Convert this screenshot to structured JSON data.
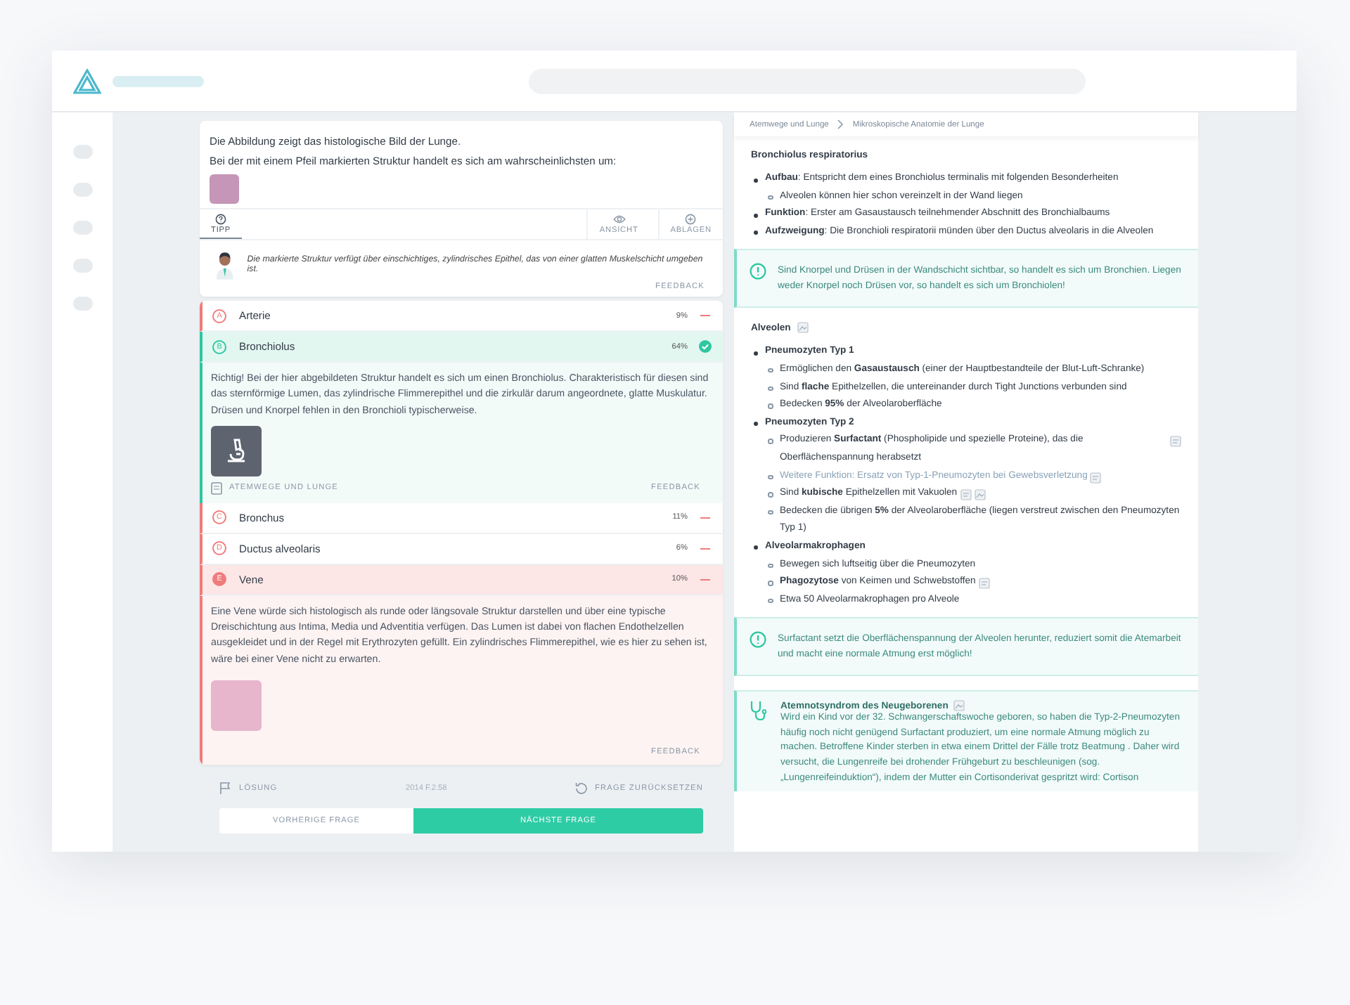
{
  "question": {
    "lines": [
      "Die Abbildung zeigt das histologische Bild der Lunge.",
      "Bei der mit einem Pfeil markierten Struktur handelt es sich am wahrscheinlichsten um:"
    ],
    "tabs": [
      {
        "label": "TIPP",
        "selected": true
      },
      {
        "label": "ANSICHT",
        "selected": false
      },
      {
        "label": "ABLAGEN",
        "selected": false
      }
    ],
    "hint": "Die markierte Struktur verfügt über einschichtiges, zylindrisches Epithel, das von einer glatten Muskelschicht umgeben ist.",
    "feedback": "FEEDBACK"
  },
  "answers": [
    {
      "letter": "A",
      "label": "Arterie",
      "percent": "9%",
      "correct": false,
      "selected": false,
      "expanded": false
    },
    {
      "letter": "B",
      "label": "Bronchiolus",
      "percent": "64%",
      "correct": true,
      "selected": false,
      "expanded": true,
      "explanation": "Richtig! Bei der hier abgebildeten Struktur handelt es sich um einen Bronchiolus. Charakteristisch für diesen sind das sternförmige Lumen, das zylindrische Flimmerepithel und die zirkulär darum angeordnete, glatte Muskulatur. Drüsen und Knorpel fehlen in den Bronchioli typischerweise.",
      "media": {
        "kind": "icon-tile"
      },
      "topic": "ATEMWEGE UND LUNGE",
      "feedback": "FEEDBACK"
    },
    {
      "letter": "C",
      "label": "Bronchus",
      "percent": "11%",
      "correct": false,
      "selected": false,
      "expanded": false
    },
    {
      "letter": "D",
      "label": "Ductus alveolaris",
      "percent": "6%",
      "correct": false,
      "selected": false,
      "expanded": false
    },
    {
      "letter": "E",
      "label": "Vene",
      "percent": "10%",
      "correct": false,
      "selected": true,
      "expanded": true,
      "explanation": "Eine Vene würde sich histologisch als runde oder längsovale Struktur darstellen und über eine typische Dreischichtung aus Intima, Media und Adventitia verfügen. Das Lumen ist dabei von flachen Endothelzellen ausgekleidet und in der Regel mit Erythrozyten gefüllt. Ein zylindrisches Flimmerepithel, wie es hier zu sehen ist, wäre bei einer Vene nicht zu erwarten.",
      "media": {
        "kind": "photo"
      },
      "feedback": "FEEDBACK"
    }
  ],
  "footer": {
    "solution": "LÖSUNG",
    "code": "2014 F.2.58",
    "reset": "FRAGE ZURÜCKSETZEN"
  },
  "nav": [
    {
      "label": "VORHERIGE FRAGE",
      "primary": false
    },
    {
      "label": "NÄCHSTE FRAGE",
      "primary": true
    }
  ],
  "breadcrumb": [
    "Atemwege und Lunge",
    "Mikroskopische Anatomie der Lunge"
  ],
  "article": [
    {
      "kind": "heading",
      "text": "Bronchiolus respiratorius"
    },
    {
      "kind": "list",
      "items": [
        {
          "text": "**Aufbau**: Entspricht dem eines Bronchiolus terminalis mit folgenden Besonderheiten",
          "bold": false,
          "children": [
            {
              "text": "Alveolen können hier schon vereinzelt in der Wand liegen",
              "muted": false
            }
          ]
        },
        {
          "text": "**Funktion**: Erster am Gasaustausch teilnehmender Abschnitt des Bronchialbaums",
          "bold": false
        },
        {
          "text": "**Aufzweigung**: Die Bronchioli respiratorii münden über den Ductus alveolaris in die Alveolen",
          "bold": false
        }
      ]
    },
    {
      "kind": "callout",
      "text": "Sind Knorpel und Drüsen in der Wandschicht sichtbar, so handelt es sich um Bronchien. Liegen weder Knorpel noch Drüsen vor, so handelt es sich um Bronchiolen!"
    },
    {
      "kind": "heading",
      "text": "Alveolen",
      "attachments": [
        {
          "kind": "image"
        }
      ]
    },
    {
      "kind": "list",
      "items": [
        {
          "text": "Pneumozyten Typ 1",
          "bold": true,
          "children": [
            {
              "text": "Ermöglichen den **Gasaustausch** (einer der Hauptbestandteile der Blut-Luft-Schranke)",
              "muted": false
            },
            {
              "text": "Sind **flache** Epithelzellen, die untereinander durch Tight Junctions verbunden sind",
              "muted": false
            },
            {
              "text": "Bedecken **95%** der Alveolaroberfläche",
              "muted": false
            }
          ]
        },
        {
          "text": "Pneumozyten Typ 2",
          "bold": true,
          "children": [
            {
              "text": "Produzieren **Surfactant** (Phospholipide und spezielle Proteine), das die Oberflächenspannung herabsetzt",
              "muted": false,
              "attachments": [
                {
                  "kind": "note"
                }
              ]
            },
            {
              "text": "Weitere Funktion: Ersatz von Typ-1-Pneumozyten bei Gewebsverletzung",
              "muted": true,
              "attachments": [
                {
                  "kind": "note"
                }
              ]
            },
            {
              "text": "Sind **kubische** Epithelzellen mit Vakuolen",
              "muted": false,
              "attachments": [
                {
                  "kind": "note"
                },
                {
                  "kind": "image"
                }
              ]
            },
            {
              "text": "Bedecken die übrigen **5%** der Alveolaroberfläche (liegen verstreut zwischen den Pneumozyten Typ 1)",
              "muted": false
            }
          ]
        },
        {
          "text": "Alveolarmakrophagen",
          "bold": true,
          "children": [
            {
              "text": "Bewegen sich luftseitig über die Pneumozyten",
              "muted": false
            },
            {
              "text": "**Phagozytose** von Keimen und Schwebstoffen",
              "muted": false,
              "attachments": [
                {
                  "kind": "note"
                }
              ]
            },
            {
              "text": "Etwa 50 Alveolarmakrophagen pro Alveole",
              "muted": false
            }
          ]
        }
      ]
    },
    {
      "kind": "callout",
      "text": "Surfactant setzt die Oberflächenspannung der Alveolen herunter, reduziert somit die Atemarbeit und macht eine normale Atmung erst möglich!"
    },
    {
      "kind": "clinic",
      "title": "Atemnotsyndrom des Neugeborenen",
      "attachments": [
        {
          "kind": "image"
        }
      ],
      "text": "Wird ein Kind vor der 32. Schwangerschaftswoche geboren, so haben die Typ-2-Pneumozyten häufig noch nicht genügend Surfactant produziert, um eine normale Atmung möglich zu machen. Betroffene Kinder sterben in etwa einem Drittel der Fälle trotz Beatmung . Daher wird versucht, die Lungenreife bei drohender Frühgeburt zu beschleunigen (sog. „Lungenreifeinduktion“), indem der Mutter ein Cortisonderivat gespritzt wird: Cortison"
    }
  ]
}
